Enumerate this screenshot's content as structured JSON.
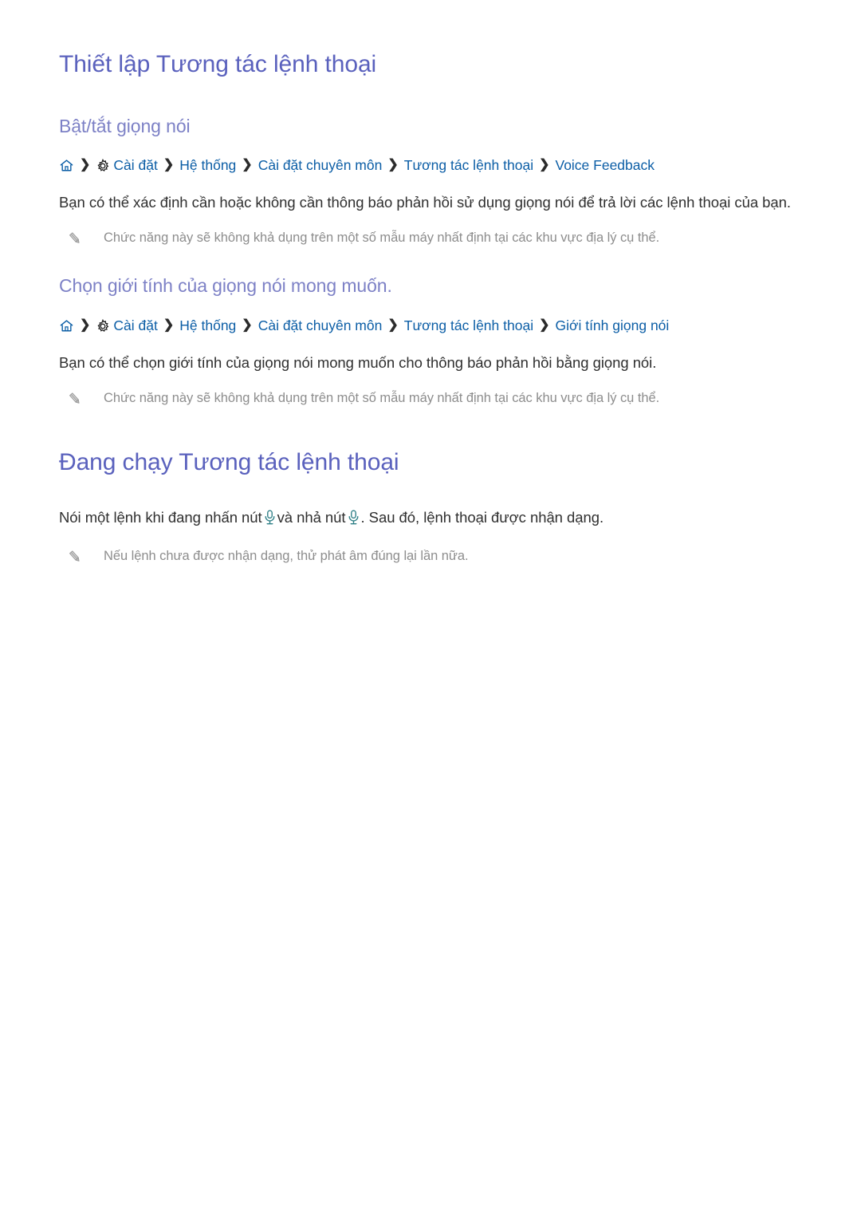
{
  "document": {
    "title": "Thiết lập Tương tác lệnh thoại",
    "second_title": "Đang chạy Tương tác lệnh thoại"
  },
  "colors": {
    "heading": "#5a61bd",
    "subheading": "#7d81c6",
    "link": "#0c5ea6",
    "body": "#2f2f2f",
    "note": "#8d8d8d",
    "mic_icon": "#2d7f86",
    "separator": "#2b2b2b"
  },
  "sections": [
    {
      "subheading": "Bật/tắt giọng nói",
      "breadcrumb": {
        "home_icon": "home-icon",
        "gear_icon": "gear-icon",
        "separator": "❯",
        "items": [
          "Cài đặt",
          "Hệ thống",
          "Cài đặt chuyên môn",
          "Tương tác lệnh thoại",
          "Voice Feedback"
        ]
      },
      "body": "Bạn có thể xác định cần hoặc không cần thông báo phản hồi sử dụng giọng nói để trả lời các lệnh thoại của bạn.",
      "note": {
        "icon": "pencil-icon",
        "text": "Chức năng này sẽ không khả dụng trên một số mẫu máy nhất định tại các khu vực địa lý cụ thể."
      }
    },
    {
      "subheading": "Chọn giới tính của giọng nói mong muốn.",
      "breadcrumb": {
        "home_icon": "home-icon",
        "gear_icon": "gear-icon",
        "separator": "❯",
        "items": [
          "Cài đặt",
          "Hệ thống",
          "Cài đặt chuyên môn",
          "Tương tác lệnh thoại",
          "Giới tính giọng nói"
        ]
      },
      "body": "Bạn có thể chọn giới tính của giọng nói mong muốn cho thông báo phản hồi bằng giọng nói.",
      "note": {
        "icon": "pencil-icon",
        "text": "Chức năng này sẽ không khả dụng trên một số mẫu máy nhất định tại các khu vực địa lý cụ thể."
      }
    }
  ],
  "running_section": {
    "body_part_1": "Nói một lệnh khi đang nhấn nút",
    "mic_icon_1": "microphone-icon",
    "body_part_2": "và nhả nút",
    "mic_icon_2": "microphone-icon",
    "body_part_3": ". Sau đó, lệnh thoại được nhận dạng.",
    "note": {
      "icon": "pencil-icon",
      "text": "Nếu lệnh chưa được nhận dạng, thử phát âm đúng lại lần nữa."
    }
  }
}
